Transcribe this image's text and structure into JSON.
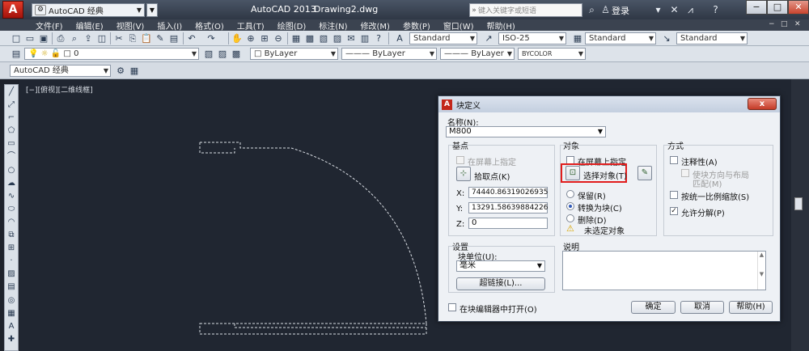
{
  "titlebar": {
    "workspace": "AutoCAD 经典",
    "app_name": "AutoCAD 2013",
    "document": "Drawing2.dwg",
    "search_placeholder": "键入关键字或短语",
    "login": "登录"
  },
  "menu": [
    "文件(F)",
    "编辑(E)",
    "视图(V)",
    "插入(I)",
    "格式(O)",
    "工具(T)",
    "绘图(D)",
    "标注(N)",
    "修改(M)",
    "参数(P)",
    "窗口(W)",
    "帮助(H)"
  ],
  "toolbars": {
    "text_style": "Standard",
    "dim_style": "ISO-25",
    "table_style": "Standard",
    "multileader_style": "Standard",
    "layer": "0",
    "color": "ByLayer",
    "linetype": "ByLayer",
    "lineweight": "ByLayer",
    "plotstyle": "BYCOLOR",
    "workspace2": "AutoCAD 经典"
  },
  "viewport_label": "[−][俯视][二维线框]",
  "dialog": {
    "title": "块定义",
    "close": "x",
    "name_label": "名称(N):",
    "name_value": "M800",
    "base_point": {
      "title": "基点",
      "specify_on_screen": "在屏幕上指定",
      "pick_point": "拾取点(K)",
      "x_label": "X:",
      "x_value": "74440.86319026935",
      "y_label": "Y:",
      "y_value": "13291.58639884226",
      "z_label": "Z:",
      "z_value": "0"
    },
    "objects": {
      "title": "对象",
      "specify_on_screen": "在屏幕上指定",
      "select_objects": "选择对象(T)",
      "retain": "保留(R)",
      "convert": "转换为块(C)",
      "delete": "删除(D)",
      "warning": "未选定对象"
    },
    "behavior": {
      "title": "方式",
      "annotative": "注释性(A)",
      "match_orientation_1": "使块方向与布局",
      "match_orientation_2": "匹配(M)",
      "scale_uniformly": "按统一比例缩放(S)",
      "allow_explode": "允许分解(P)"
    },
    "settings": {
      "title": "设置",
      "unit_label": "块单位(U):",
      "unit_value": "毫米",
      "hyperlink": "超链接(L)..."
    },
    "description_label": "说明",
    "open_in_editor": "在块编辑器中打开(O)",
    "ok": "确定",
    "cancel": "取消",
    "help": "帮助(H)"
  }
}
